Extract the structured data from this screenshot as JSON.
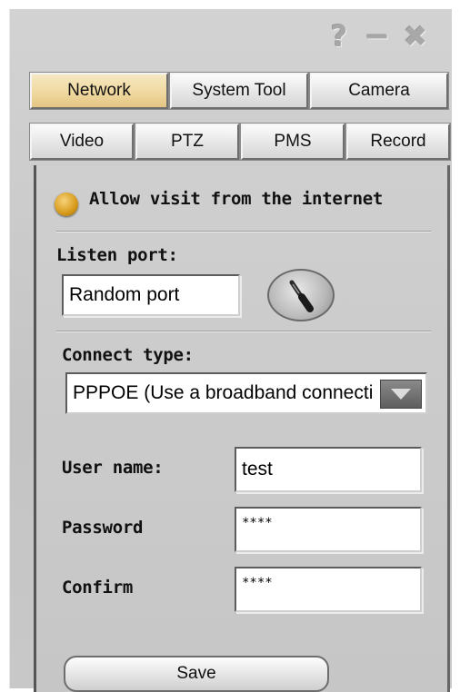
{
  "titlebar": {
    "help": "?",
    "minimize": "−",
    "close": "✖"
  },
  "tabs_row1": [
    {
      "label": "Network",
      "active": true
    },
    {
      "label": "System Tool",
      "active": false
    },
    {
      "label": "Camera",
      "active": false
    }
  ],
  "tabs_row2": [
    {
      "label": "Video"
    },
    {
      "label": "PTZ"
    },
    {
      "label": "PMS"
    },
    {
      "label": "Record"
    }
  ],
  "network": {
    "allow_visit_label": "Allow visit from the internet",
    "allow_visit_checked": true,
    "listen_port_label": "Listen port:",
    "listen_port_value": "Random port",
    "connect_type_label": "Connect type:",
    "connect_type_value": "PPPOE (Use a broadband connection)",
    "username_label": "User name:",
    "username_value": "test",
    "password_label": "Password",
    "password_value": "****",
    "confirm_label": "Confirm",
    "confirm_value": "****",
    "save_label": "Save"
  },
  "icons": {
    "tool": "screwdriver-icon",
    "dropdown": "chevron-down-icon"
  },
  "colors": {
    "active_tab": "#f0d9a0",
    "radio": "#d69a1a",
    "window_bg": "#c8c8c8"
  }
}
